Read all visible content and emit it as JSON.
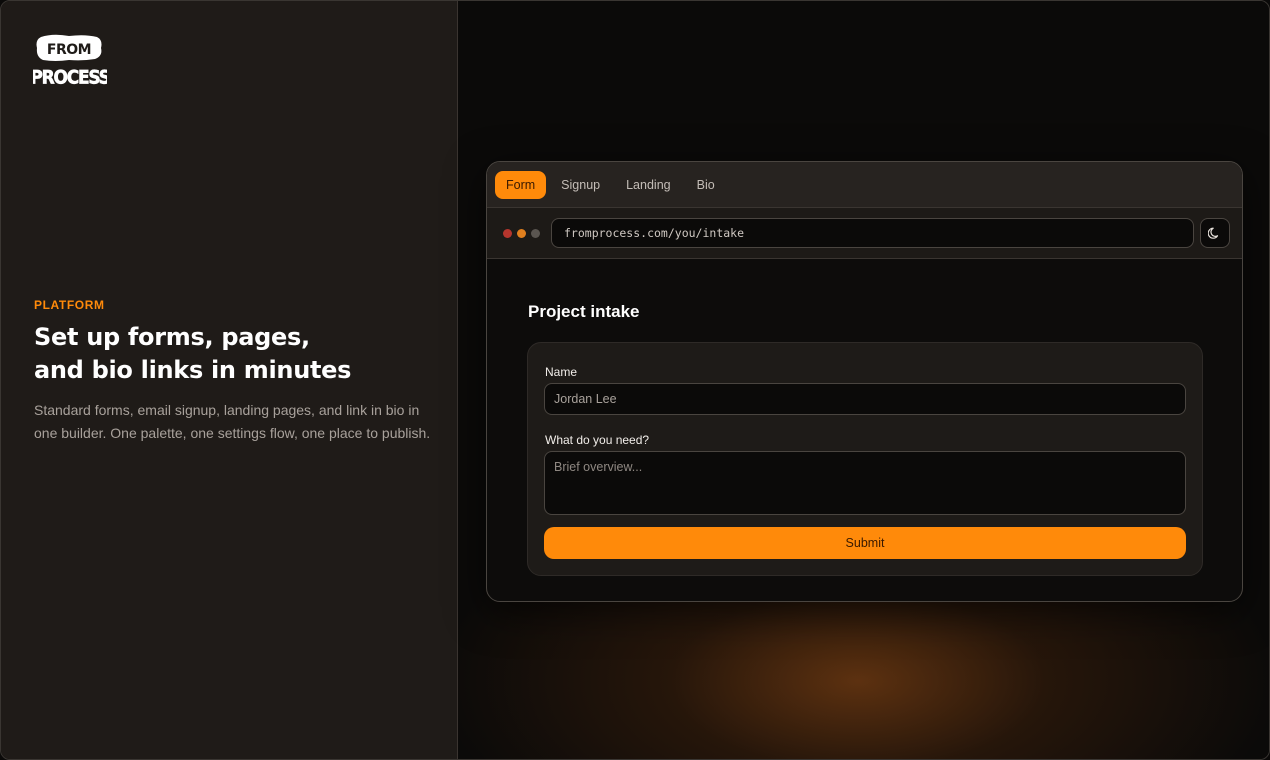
{
  "brand": {
    "logo_text": [
      "FROM",
      "PROCESS"
    ],
    "accent": "#ff8a0a"
  },
  "hero": {
    "eyebrow": "PLATFORM",
    "headline_line1": "Set up forms, pages,",
    "headline_line2": "and bio links in minutes",
    "description": "Standard forms, email signup, landing pages, and link in bio in one builder. One palette, one settings flow, one place to publish."
  },
  "preview": {
    "tabs": [
      {
        "label": "Form",
        "active": true
      },
      {
        "label": "Signup",
        "active": false
      },
      {
        "label": "Landing",
        "active": false
      },
      {
        "label": "Bio",
        "active": false
      }
    ],
    "address": "fromprocess.com/you/intake",
    "theme_toggle_icon": "moon-icon",
    "window_dots": [
      "#b5352d",
      "#e07f1e",
      "#5a5550"
    ],
    "page": {
      "title": "Project intake",
      "name_label": "Name",
      "name_value": "Jordan Lee",
      "need_label": "What do you need?",
      "need_placeholder": "Brief overview...",
      "submit_label": "Submit"
    }
  }
}
